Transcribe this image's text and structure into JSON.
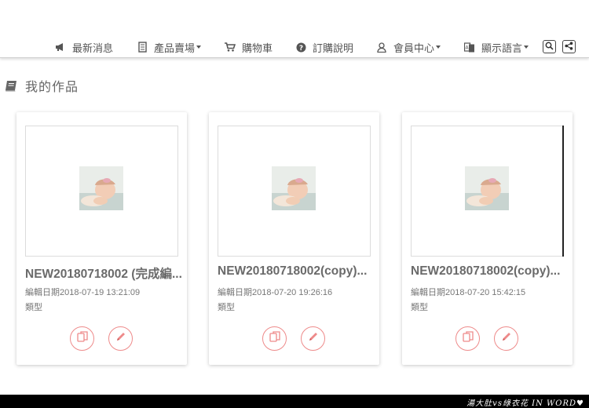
{
  "nav": {
    "items": [
      {
        "label": "最新消息",
        "icon": "megaphone-icon",
        "caret": false
      },
      {
        "label": "產品賣場",
        "icon": "document-icon",
        "caret": true
      },
      {
        "label": "購物車",
        "icon": "cart-icon",
        "caret": false
      },
      {
        "label": "訂購說明",
        "icon": "question-circle-icon",
        "caret": false
      },
      {
        "label": "會員中心",
        "icon": "user-icon",
        "caret": true
      },
      {
        "label": "顯示語言",
        "icon": "language-icon",
        "caret": true
      }
    ],
    "buttons": [
      {
        "name": "search-button",
        "icon": "search-icon"
      },
      {
        "name": "share-button",
        "icon": "share-icon"
      }
    ]
  },
  "section": {
    "title": "我的作品",
    "icon": "book-icon"
  },
  "cards": [
    {
      "title": "NEW20180718002 (完成編...",
      "date": "編輯日期2018-07-19 13:21:09",
      "type": "類型"
    },
    {
      "title": "NEW20180718002(copy)...",
      "date": "編輯日期2018-07-20 19:26:16",
      "type": "類型"
    },
    {
      "title": "NEW20180718002(copy)...",
      "date": "編輯日期2018-07-20 15:42:15",
      "type": "類型"
    }
  ],
  "card_actions": {
    "copy_icon": "copy-icon",
    "edit_icon": "pencil-icon"
  },
  "colors": {
    "accent": "#ee8a8a",
    "footer": "#000000"
  },
  "footer": {
    "text": "湯大肚vs綠衣花 IN WORD♥"
  }
}
